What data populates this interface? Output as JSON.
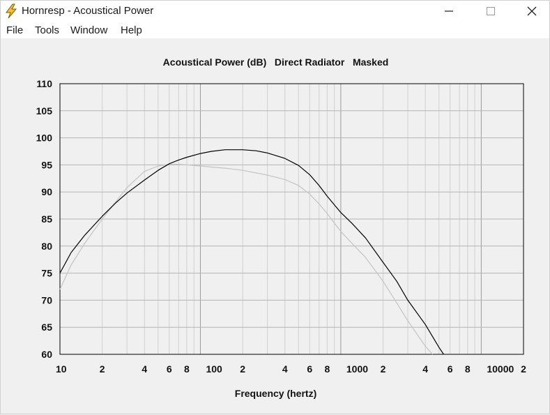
{
  "window": {
    "title": "Hornresp - Acoustical Power",
    "icon": "lightning-bolt-icon",
    "controls": [
      "minimize-icon",
      "maximize-icon",
      "close-icon"
    ]
  },
  "menu": {
    "items": [
      "File",
      "Tools",
      "Window",
      "Help"
    ]
  },
  "chart_data": {
    "type": "line",
    "title": "Acoustical Power (dB)   Direct Radiator   Masked",
    "xlabel": "Frequency (hertz)",
    "ylabel": "",
    "xscale": "log",
    "xlim": [
      10,
      20000
    ],
    "ylim": [
      60,
      110
    ],
    "grid": true,
    "y_ticks": [
      "60",
      "65",
      "70",
      "75",
      "80",
      "85",
      "90",
      "95",
      "100",
      "105",
      "110"
    ],
    "x_ticks": [
      {
        "value": 10,
        "label": "10"
      },
      {
        "value": 20,
        "label": "2"
      },
      {
        "value": 40,
        "label": "4"
      },
      {
        "value": 60,
        "label": "6"
      },
      {
        "value": 80,
        "label": "8"
      },
      {
        "value": 100,
        "label": "100"
      },
      {
        "value": 200,
        "label": "2"
      },
      {
        "value": 400,
        "label": "4"
      },
      {
        "value": 600,
        "label": "6"
      },
      {
        "value": 800,
        "label": "8"
      },
      {
        "value": 1000,
        "label": "1000"
      },
      {
        "value": 2000,
        "label": "2"
      },
      {
        "value": 4000,
        "label": "4"
      },
      {
        "value": 6000,
        "label": "6"
      },
      {
        "value": 8000,
        "label": "8"
      },
      {
        "value": 10000,
        "label": "10000"
      },
      {
        "value": 20000,
        "label": "2"
      }
    ],
    "series": [
      {
        "color": "#000000",
        "x": [
          10,
          12,
          15,
          20,
          25,
          30,
          40,
          50,
          60,
          70,
          80,
          100,
          120,
          150,
          200,
          250,
          300,
          400,
          500,
          600,
          700,
          800,
          1000,
          1200,
          1500,
          2000,
          2500,
          3000,
          4000,
          5000,
          5400
        ],
        "y": [
          75,
          78.8,
          82,
          85.5,
          88,
          89.8,
          92.2,
          94,
          95.2,
          95.9,
          96.4,
          97.1,
          97.5,
          97.8,
          97.8,
          97.6,
          97.2,
          96.2,
          94.9,
          93.2,
          91.2,
          89.2,
          86.2,
          84.2,
          81.5,
          77,
          73.5,
          70,
          65.5,
          61.3,
          60
        ]
      },
      {
        "color": "#c4c4c4",
        "x": [
          10,
          12,
          15,
          20,
          25,
          30,
          40,
          50,
          60,
          70,
          80,
          100,
          120,
          150,
          200,
          250,
          300,
          400,
          500,
          600,
          700,
          800,
          1000,
          1200,
          1500,
          2000,
          2500,
          3000,
          4000,
          4500
        ],
        "y": [
          72,
          76.5,
          80.5,
          85,
          88.2,
          90.8,
          93.8,
          94.8,
          95.1,
          95.1,
          95,
          94.8,
          94.6,
          94.4,
          94,
          93.5,
          93.1,
          92.3,
          91.2,
          89.6,
          87.8,
          86,
          82.7,
          80.5,
          77.9,
          73.5,
          69.5,
          66.2,
          61.5,
          60
        ]
      }
    ]
  }
}
